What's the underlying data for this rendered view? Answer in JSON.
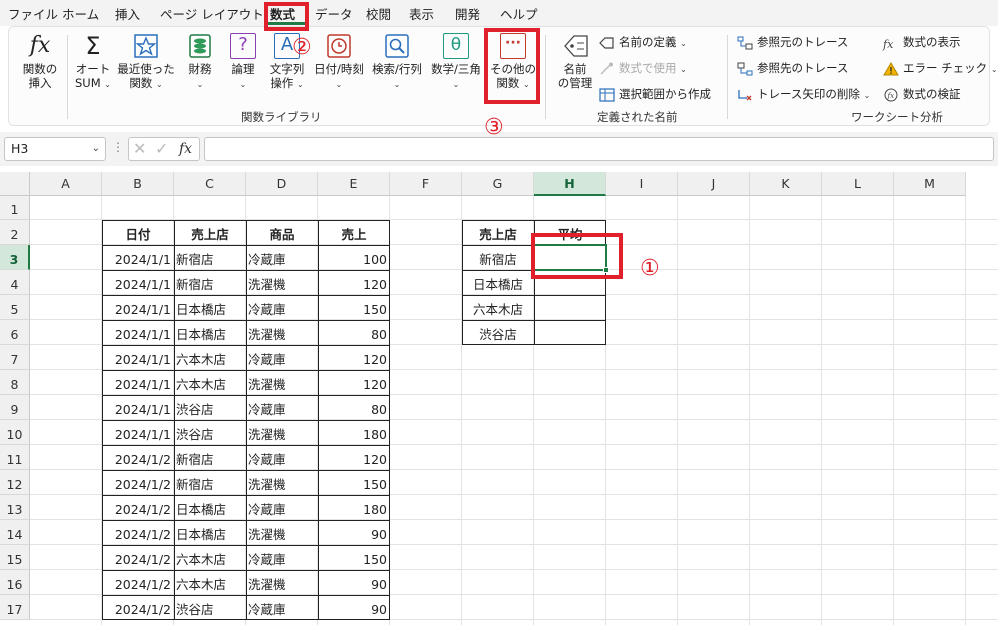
{
  "menu": {
    "items": [
      "ファイル",
      "ホーム",
      "挿入",
      "ページ レイアウト",
      "数式",
      "データ",
      "校閲",
      "表示",
      "開発",
      "ヘルプ"
    ],
    "active_index": 4
  },
  "ribbon": {
    "insert_function": {
      "label1": "関数の",
      "label2": "挿入",
      "icon_text": "fx"
    },
    "autosum": {
      "label1": "オート",
      "label2": "SUM",
      "icon_text": "Σ"
    },
    "recent": {
      "label1": "最近使った",
      "label2": "関数"
    },
    "financial": {
      "label1": "財務"
    },
    "logical": {
      "label1": "論理",
      "icon_text": "?"
    },
    "text": {
      "label1": "文字列",
      "label2": "操作",
      "icon_text": "A"
    },
    "datetime": {
      "label1": "日付/時刻"
    },
    "lookup": {
      "label1": "検索/行列"
    },
    "math": {
      "label1": "数学/三角",
      "icon_text": "θ"
    },
    "more": {
      "label1": "その他の",
      "label2": "関数",
      "icon_text": "···"
    },
    "function_library_label": "関数ライブラリ",
    "name_manager": {
      "label1": "名前",
      "label2": "の管理"
    },
    "define_name": "名前の定義",
    "use_in_formula": "数式で使用",
    "create_from_selection": "選択範囲から作成",
    "defined_names_label": "定義された名前",
    "trace_precedents": "参照元のトレース",
    "trace_dependents": "参照先のトレース",
    "remove_arrows": "トレース矢印の削除",
    "show_formulas": "数式の表示",
    "error_check": "エラー チェック",
    "evaluate_formula": "数式の検証",
    "formula_auditing_label": "ワークシート分析",
    "accent_color": "#1f7a44"
  },
  "formula_bar": {
    "name_box": "H3",
    "fx": "fx",
    "value": ""
  },
  "sheet": {
    "columns": [
      "A",
      "B",
      "C",
      "D",
      "E",
      "F",
      "G",
      "H",
      "I",
      "J",
      "K",
      "L",
      "M"
    ],
    "rows": [
      "1",
      "2",
      "3",
      "4",
      "5",
      "6",
      "7",
      "8",
      "9",
      "10",
      "11",
      "12",
      "13",
      "14",
      "15",
      "16",
      "17"
    ],
    "selected_cell": "H3",
    "table1": {
      "headers": [
        "日付",
        "売上店",
        "商品",
        "売上"
      ],
      "rows": [
        [
          "2024/1/1",
          "新宿店",
          "冷蔵庫",
          "100"
        ],
        [
          "2024/1/1",
          "新宿店",
          "洗濯機",
          "120"
        ],
        [
          "2024/1/1",
          "日本橋店",
          "冷蔵庫",
          "150"
        ],
        [
          "2024/1/1",
          "日本橋店",
          "洗濯機",
          "80"
        ],
        [
          "2024/1/1",
          "六本木店",
          "冷蔵庫",
          "120"
        ],
        [
          "2024/1/1",
          "六本木店",
          "洗濯機",
          "120"
        ],
        [
          "2024/1/1",
          "渋谷店",
          "冷蔵庫",
          "80"
        ],
        [
          "2024/1/1",
          "渋谷店",
          "洗濯機",
          "180"
        ],
        [
          "2024/1/2",
          "新宿店",
          "冷蔵庫",
          "120"
        ],
        [
          "2024/1/2",
          "新宿店",
          "洗濯機",
          "150"
        ],
        [
          "2024/1/2",
          "日本橋店",
          "冷蔵庫",
          "180"
        ],
        [
          "2024/1/2",
          "日本橋店",
          "洗濯機",
          "90"
        ],
        [
          "2024/1/2",
          "六本木店",
          "冷蔵庫",
          "150"
        ],
        [
          "2024/1/2",
          "六本木店",
          "洗濯機",
          "90"
        ],
        [
          "2024/1/2",
          "渋谷店",
          "冷蔵庫",
          "90"
        ]
      ]
    },
    "table2": {
      "headers": [
        "売上店",
        "平均"
      ],
      "rows": [
        [
          "新宿店",
          ""
        ],
        [
          "日本橋店",
          ""
        ],
        [
          "六本木店",
          ""
        ],
        [
          "渋谷店",
          ""
        ]
      ]
    }
  },
  "annotations": {
    "n1": "①",
    "n2": "②",
    "n3": "③",
    "color": "#e0202a"
  }
}
